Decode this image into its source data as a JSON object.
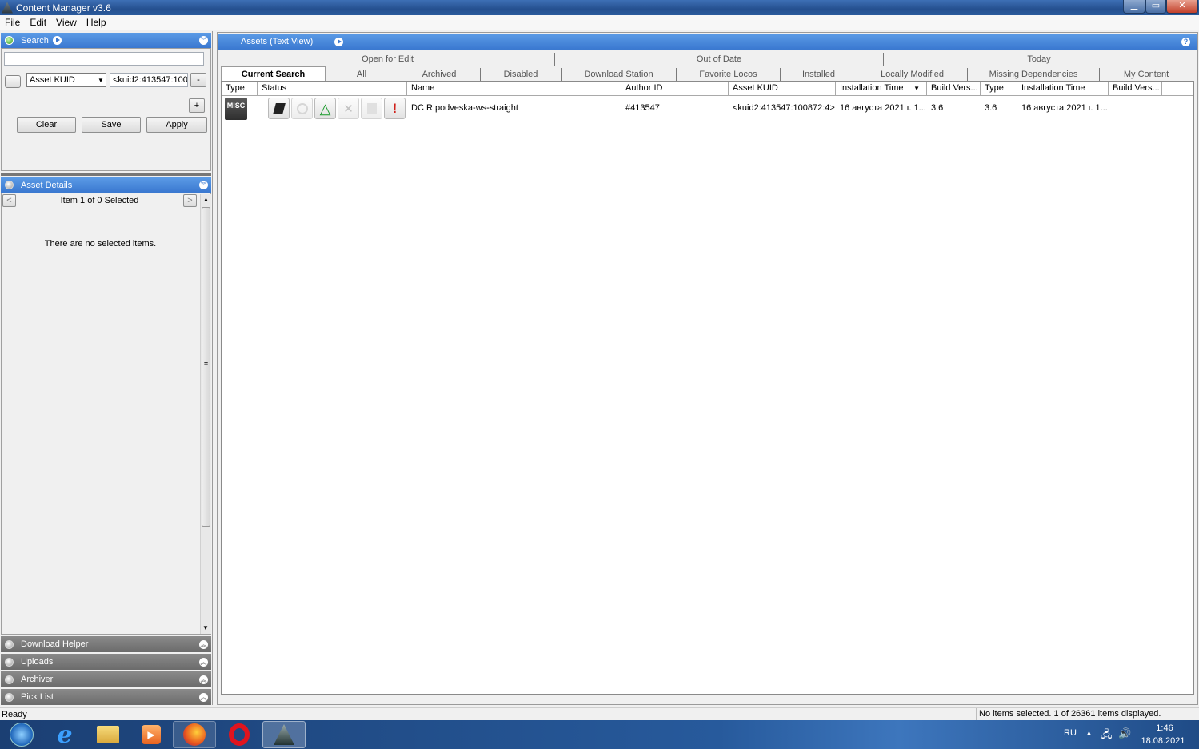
{
  "window": {
    "title": "Content Manager v3.6"
  },
  "menu": [
    "File",
    "Edit",
    "View",
    "Help"
  ],
  "search_panel": {
    "title": "Search",
    "query_value": "",
    "filter_field": "Asset KUID",
    "filter_value": "<kuid2:413547:1008",
    "minus_label": "-",
    "plus_label": "+",
    "clear_label": "Clear",
    "save_label": "Save",
    "apply_label": "Apply"
  },
  "details_panel": {
    "title": "Asset Details",
    "prev_label": "<",
    "next_label": ">",
    "item_text": "Item 1 of 0 Selected",
    "empty_text": "There are no selected items."
  },
  "collapsed_panels": [
    "Download Helper",
    "Uploads",
    "Archiver",
    "Pick List"
  ],
  "assets_view": {
    "title": "Assets (Text View)"
  },
  "tabs_top": [
    "Open for Edit",
    "Out of Date",
    "Today"
  ],
  "tabs_bottom": [
    "Current Search",
    "All",
    "Archived",
    "Disabled",
    "Download Station",
    "Favorite Locos",
    "Installed",
    "Locally Modified",
    "Missing Dependencies",
    "My Content"
  ],
  "active_tab": "Current Search",
  "columns": [
    "Type",
    "Status",
    "Name",
    "Author ID",
    "Asset KUID",
    "Installation Time",
    "Build Vers...",
    "Type",
    "Installation Time",
    "Build Vers..."
  ],
  "sorted_column": "Installation Time",
  "rows": [
    {
      "type_badge": "MISC",
      "name": "DC R podveska-ws-straight",
      "author_id": "#413547",
      "kuid": "<kuid2:413547:100872:4>",
      "install_time": "16 августа 2021 г. 1...",
      "build": "3.6",
      "type2": "3.6",
      "install_time2": "16 августа 2021 г. 1...",
      "build2": ""
    }
  ],
  "status_bar": {
    "left": "Ready",
    "right": "No items selected. 1 of 26361 items displayed."
  },
  "taskbar": {
    "apps": [
      "start-orb",
      "internet-explorer",
      "file-explorer",
      "media-player",
      "firefox",
      "opera",
      "trainz-content-manager"
    ],
    "lang": "RU",
    "time": "1:46",
    "date": "18.08.2021"
  }
}
